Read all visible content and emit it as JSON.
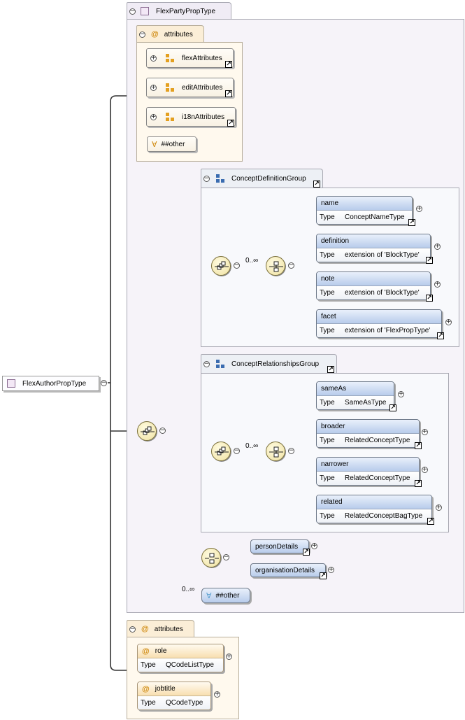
{
  "root": {
    "name": "FlexAuthorPropType"
  },
  "base_type": {
    "name": "FlexPartyPropType"
  },
  "base_attributes": {
    "title": "attributes",
    "groups": [
      "flexAttributes",
      "editAttributes",
      "i18nAttributes"
    ],
    "any_attribute": "##other"
  },
  "concept_definition_group": {
    "title": "ConceptDefinitionGroup",
    "occurs": "0..∞",
    "elements": [
      {
        "name": "name",
        "type_label": "Type",
        "type": "ConceptNameType"
      },
      {
        "name": "definition",
        "type_label": "Type",
        "type": "extension of 'BlockType'"
      },
      {
        "name": "note",
        "type_label": "Type",
        "type": "extension of 'BlockType'"
      },
      {
        "name": "facet",
        "type_label": "Type",
        "type": "extension of 'FlexPropType'"
      }
    ]
  },
  "concept_relationships_group": {
    "title": "ConceptRelationshipsGroup",
    "occurs": "0..∞",
    "elements": [
      {
        "name": "sameAs",
        "type_label": "Type",
        "type": "SameAsType"
      },
      {
        "name": "broader",
        "type_label": "Type",
        "type": "RelatedConceptType"
      },
      {
        "name": "narrower",
        "type_label": "Type",
        "type": "RelatedConceptType"
      },
      {
        "name": "related",
        "type_label": "Type",
        "type": "RelatedConceptBagType"
      }
    ]
  },
  "choice_elements": [
    "personDetails",
    "organisationDetails"
  ],
  "any_element": {
    "occurs": "0..∞",
    "label": "##other"
  },
  "own_attributes": {
    "title": "attributes",
    "items": [
      {
        "name": "role",
        "type_label": "Type",
        "type": "QCodeListType"
      },
      {
        "name": "jobtitle",
        "type_label": "Type",
        "type": "QCodeType"
      }
    ]
  },
  "symbols": {
    "collapse": "−",
    "expand": "+",
    "attribute": "@",
    "any": "∀",
    "ref": "↗"
  }
}
